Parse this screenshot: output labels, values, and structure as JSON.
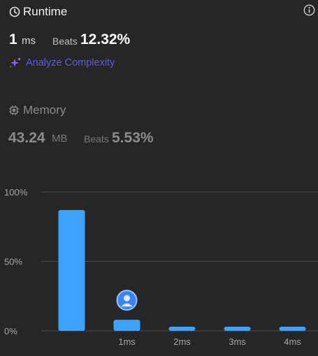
{
  "runtime": {
    "title": "Runtime",
    "value": "1",
    "unit": "ms",
    "beats_label": "Beats",
    "beats_value": "12.32%",
    "icon": "clock-icon"
  },
  "info_icon": "info-icon",
  "analyze": {
    "label": "Analyze Complexity",
    "icon": "sparkle-icon",
    "color": "#5b5fd8"
  },
  "memory": {
    "title": "Memory",
    "value": "43.24",
    "unit": "MB",
    "beats_label": "Beats",
    "beats_value": "5.53%",
    "icon": "chip-icon"
  },
  "chart_data": {
    "type": "bar",
    "y_tick_labels": [
      "100%",
      "50%",
      "0%"
    ],
    "ylim": [
      0,
      100
    ],
    "categories": [
      "",
      "1ms",
      "2ms",
      "3ms",
      "4ms"
    ],
    "values": [
      87,
      8,
      3,
      3,
      3
    ],
    "bar_color": "#3ba3ff",
    "grid": true,
    "marker": {
      "category": "1ms",
      "icon": "user-avatar-icon"
    }
  }
}
